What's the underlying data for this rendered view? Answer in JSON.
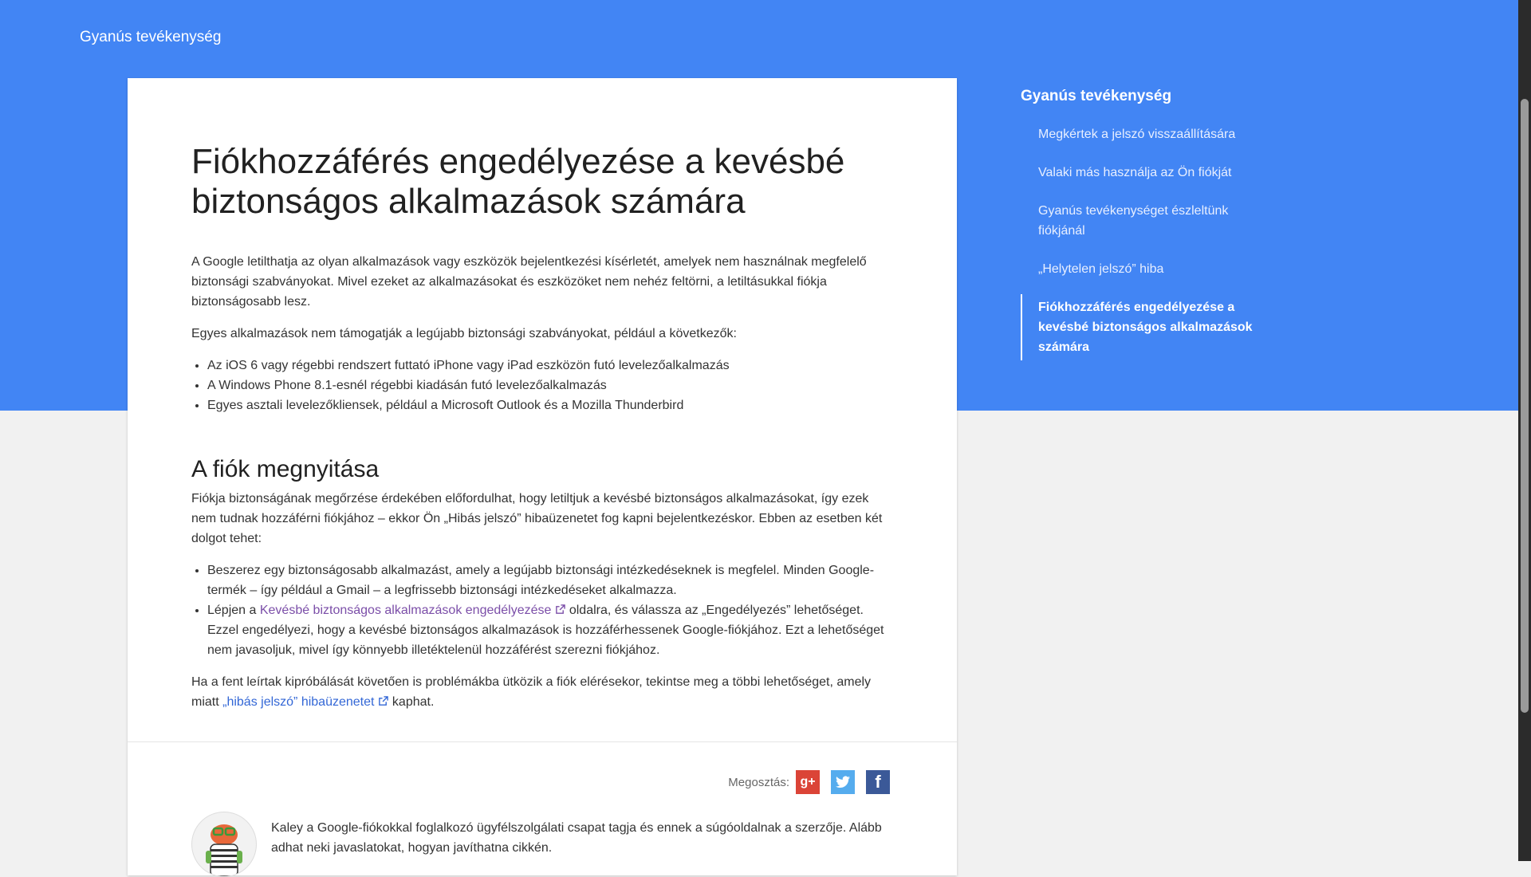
{
  "header": {
    "site_title": "Gyanús tevékenység"
  },
  "article": {
    "title": "Fiókhozzáférés engedélyezése a kevésbé biztonságos alkalmazások számára",
    "intro": "A Google letilthatja az olyan alkalmazások vagy eszközök bejelentkezési kísérletét, amelyek nem használnak megfelelő biztonsági szabványokat. Mivel ezeket az alkalmazásokat és eszközöket nem nehéz feltörni, a letiltásukkal fiókja biztonságosabb lesz.",
    "examples_intro": "Egyes alkalmazások nem támogatják a legújabb biztonsági szabványokat, például a következők:",
    "examples": [
      "Az iOS 6 vagy régebbi rendszert futtató iPhone vagy iPad eszközön futó levelezőalkalmazás",
      "A Windows Phone 8.1-esnél régebbi kiadásán futó levelezőalkalmazás",
      "Egyes asztali levelezőkliensek, például a Microsoft Outlook és a Mozilla Thunderbird"
    ],
    "section_title": "A fiók megnyitása",
    "section_intro": "Fiókja biztonságának megőrzése érdekében előfordulhat, hogy letiltjuk a kevésbé biztonságos alkalmazásokat, így ezek nem tudnak hozzáférni fiókjához – ekkor Ön „Hibás jelszó” hibaüzenetet fog kapni bejelentkezéskor. Ebben az esetben két dolgot tehet:",
    "option1": "Beszerez egy biztonságosabb alkalmazást, amely a legújabb biztonsági intézkedéseknek is megfelel. Minden Google-termék – így például a Gmail – a legfrissebb biztonsági intézkedéseket alkalmazza.",
    "option2_before": "Lépjen a ",
    "option2_link": "Kevésbé biztonságos alkalmazások engedélyezése",
    "option2_after": " oldalra, és válassza az „Engedélyezés” lehetőséget. Ezzel engedélyezi, hogy a kevésbé biztonságos alkalmazások is hozzáférhessenek Google-fiókjához. Ezt a lehetőséget nem javasoljuk, mivel így könnyebb illetéktelenül hozzáférést szerezni fiókjához.",
    "closing_before": "Ha a fent leírtak kipróbálását követően is problémákba ütközik a fiók elérésekor, tekintse meg a többi lehetőséget, amely miatt ",
    "closing_link": "„hibás jelszó” hibaüzenetet",
    "closing_after": " kaphat."
  },
  "share": {
    "label": "Megosztás:",
    "icons": [
      "google-plus-icon",
      "twitter-icon",
      "facebook-icon"
    ],
    "gplus_glyph": "g+",
    "facebook_glyph": "f"
  },
  "author": {
    "bio": "Kaley a Google-fiókokkal foglalkozó ügyfélszolgálati csapat tagja és ennek a súgóoldalnak a szerzője. Alább adhat neki javaslatokat, hogyan javíthatna cikkén."
  },
  "sidebar": {
    "title": "Gyanús tevékenység",
    "items": [
      {
        "label": "Megkértek a jelszó visszaállítására"
      },
      {
        "label": "Valaki más használja az Ön fiókját"
      },
      {
        "label": "Gyanús tevékenységet észleltünk fiókjánál"
      },
      {
        "label": "„Helytelen jelszó” hiba"
      },
      {
        "label": "Fiókhozzáférés engedélyezése a kevésbé biztonságos alkalmazások számára",
        "active": true
      }
    ]
  },
  "colors": {
    "header_blue": "#4285f4",
    "link_blue": "#3367d6",
    "visited_link": "#7b4ea8",
    "google_plus": "#db4437",
    "twitter": "#55acee",
    "facebook": "#3b5998"
  }
}
